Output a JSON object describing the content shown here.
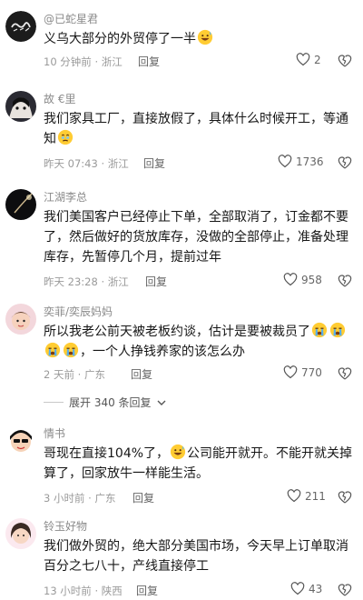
{
  "colors": {
    "text": "#161616",
    "meta": "#9a9a9a",
    "name": "#8a8a8a",
    "accent": "#e84a5f"
  },
  "comments": [
    {
      "username": "@已蛇星君",
      "text_parts": [
        "义乌大部分的外贸停了一半"
      ],
      "emojis": [
        "grin-sweat-emoji"
      ],
      "time_loc": "10 分钟前 · 浙江",
      "reply": "回复",
      "likes": "2",
      "avatar_icon": "text-avatar-icon"
    },
    {
      "username": "故 €里",
      "text_parts": [
        "我们家具工厂，直接放假了，具体什么时候开工，等通知"
      ],
      "emojis": [
        "holding-tears-emoji"
      ],
      "time_loc": "昨天 07:43 · 浙江",
      "reply": "回复",
      "likes": "1736",
      "avatar_icon": "anime-avatar-icon"
    },
    {
      "username": "江湖李总",
      "text_parts": [
        "我们美国客户已经停止下单，全部取消了，订金都不要了，然后做好的货放库存，没做的全部停止，准备处理库存，先暂停几个月，提前过年"
      ],
      "emojis": [],
      "time_loc": "昨天 23:28 · 浙江",
      "reply": "回复",
      "likes": "958",
      "avatar_icon": "dark-avatar-icon"
    },
    {
      "username": "奕菲/奕辰妈妈",
      "text_parts": [
        "所以我老公前天被老板约谈，估计是要被裁员了",
        "，一个人挣钱养家的该怎么办"
      ],
      "emojis": [
        "crying-emoji",
        "crying-emoji",
        "crying-emoji",
        "crying-emoji"
      ],
      "time_loc": "2 天前 · 广东",
      "reply": "回复",
      "likes": "770",
      "avatar_icon": "child-avatar-icon"
    },
    {
      "username": "情书",
      "text_parts": [
        "哥现在直接104%了，",
        "公司能开就开。不能开就关掉算了，回家放牛一样能生活。"
      ],
      "emojis": [
        "grin-sweat-emoji"
      ],
      "time_loc": "3 小时前 · 广东",
      "reply": "回复",
      "likes": "211",
      "avatar_icon": "cartoon-avatar-icon"
    },
    {
      "username": "铃玉好物",
      "text_parts": [
        "我们做外贸的，绝大部分美国市场，今天早上订单取消百分之七八十，产线直接停工"
      ],
      "emojis": [],
      "time_loc": "13 小时前 · 陕西",
      "reply": "回复",
      "likes": "43",
      "avatar_icon": "girl-avatar-icon"
    }
  ],
  "expand": {
    "label": "展开 340 条回复"
  }
}
